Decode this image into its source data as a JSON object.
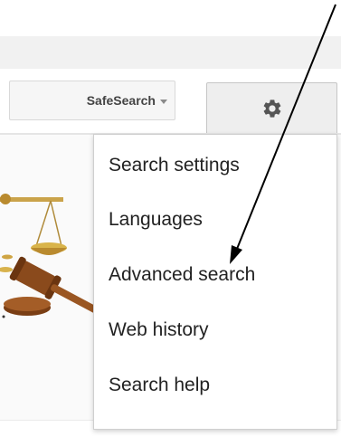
{
  "toolbar": {
    "safesearch_label": "SafeSearch",
    "settings_icon": "gear-icon"
  },
  "menu": {
    "items": [
      {
        "label": "Search settings"
      },
      {
        "label": "Languages"
      },
      {
        "label": "Advanced search"
      },
      {
        "label": "Web history"
      },
      {
        "label": "Search help"
      }
    ]
  },
  "annotation": {
    "type": "hand-drawn arrow",
    "points_to": "Advanced search",
    "color": "#000000"
  },
  "colors": {
    "menu_text": "#222222",
    "button_bg": "#eeeeee",
    "toolbar_bg": "#f1f1f1"
  }
}
